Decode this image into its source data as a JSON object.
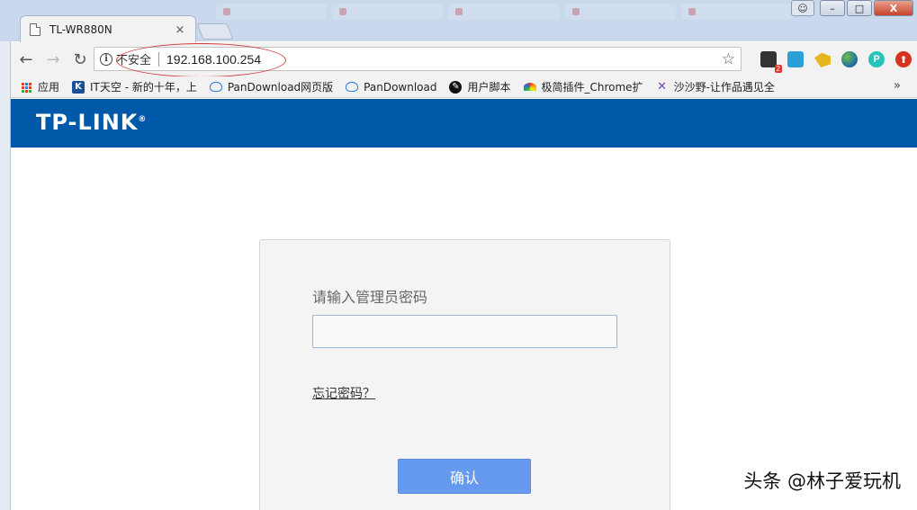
{
  "browser": {
    "tab_title": "TL-WR880N",
    "tab_close": "×",
    "security_label": "不安全",
    "url": "192.168.100.254",
    "window_controls": {
      "minimize": "–",
      "maximize": "□",
      "close": "X"
    },
    "extensions": {
      "ext1_badge": "2",
      "ext5_letter": "P",
      "ext6_glyph": "⬆"
    },
    "bookmarks": [
      {
        "label": "应用",
        "icon": "apps-grid-icon"
      },
      {
        "label": "IT天空 - 新的十年，上",
        "icon": "it-tiankong-icon"
      },
      {
        "label": "PanDownload网页版",
        "icon": "cloud-icon"
      },
      {
        "label": "PanDownload",
        "icon": "cloud-icon"
      },
      {
        "label": "用户脚本",
        "icon": "user-script-icon"
      },
      {
        "label": "极简插件_Chrome扩",
        "icon": "rainbow-icon"
      },
      {
        "label": "沙沙野-让作品遇见全",
        "icon": "shasha-icon"
      }
    ],
    "bookmarks_more": "»"
  },
  "page": {
    "brand": "TP-LINK",
    "brand_mark": "®",
    "login": {
      "password_label": "请输入管理员密码",
      "password_value": "",
      "forgot_link": "忘记密码？",
      "confirm_button": "确认"
    }
  },
  "watermark": "头条 @林子爱玩机",
  "colors": {
    "brand_bar": "#0058a8",
    "confirm_button": "#6699f0",
    "annotation_ring": "#d23a3a"
  }
}
